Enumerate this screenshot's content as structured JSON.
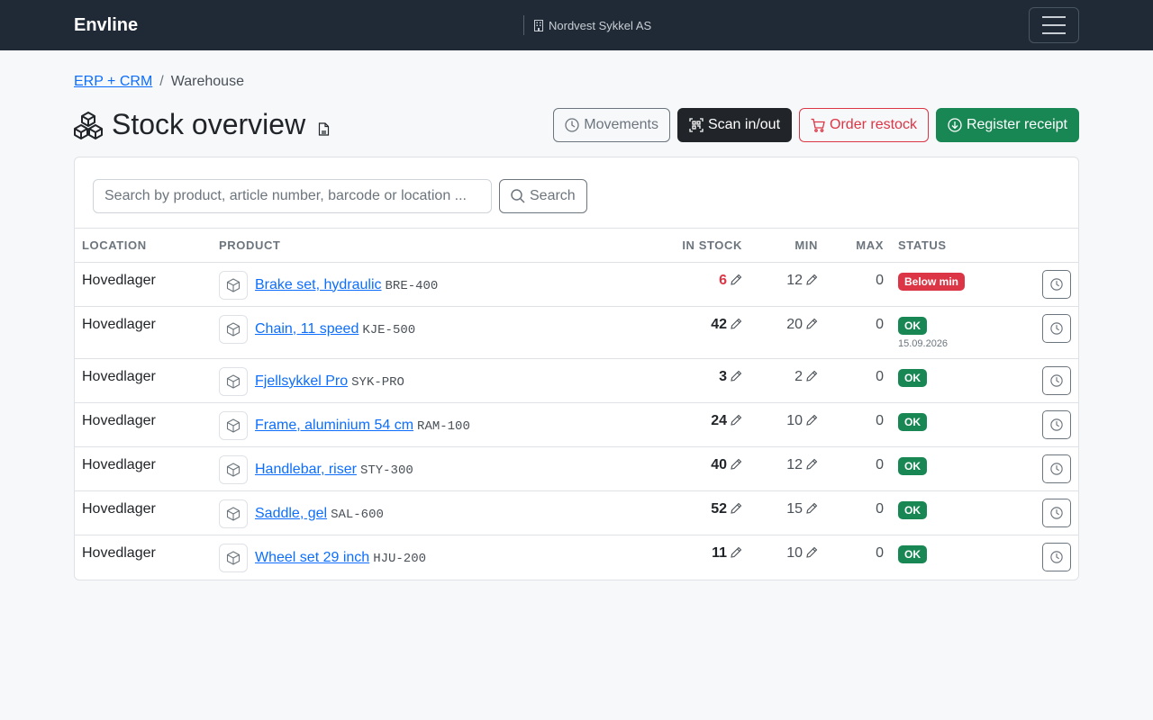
{
  "navbar": {
    "brand": "Envline",
    "company": "Nordvest Sykkel AS"
  },
  "breadcrumb": {
    "root": "ERP + CRM",
    "separator": "/",
    "current": "Warehouse"
  },
  "page": {
    "title": "Stock overview"
  },
  "actions": {
    "movements": "Movements",
    "scan": "Scan in/out",
    "restock": "Order restock",
    "receipt": "Register receipt"
  },
  "search": {
    "placeholder": "Search by product, article number, barcode or location ...",
    "button": "Search"
  },
  "table": {
    "headers": {
      "location": "LOCATION",
      "product": "PRODUCT",
      "in_stock": "IN STOCK",
      "min": "MIN",
      "max": "MAX",
      "status": "STATUS"
    },
    "rows": [
      {
        "location": "Hovedlager",
        "product": "Brake set, hydraulic",
        "sku": "BRE-400",
        "in_stock": "6",
        "min": "12",
        "max": "0",
        "status": "Below min",
        "status_note": ""
      },
      {
        "location": "Hovedlager",
        "product": "Chain, 11 speed",
        "sku": "KJE-500",
        "in_stock": "42",
        "min": "20",
        "max": "0",
        "status": "OK",
        "status_note": "15.09.2026"
      },
      {
        "location": "Hovedlager",
        "product": "Fjellsykkel Pro",
        "sku": "SYK-PRO",
        "in_stock": "3",
        "min": "2",
        "max": "0",
        "status": "OK",
        "status_note": ""
      },
      {
        "location": "Hovedlager",
        "product": "Frame, aluminium 54 cm",
        "sku": "RAM-100",
        "in_stock": "24",
        "min": "10",
        "max": "0",
        "status": "OK",
        "status_note": ""
      },
      {
        "location": "Hovedlager",
        "product": "Handlebar, riser",
        "sku": "STY-300",
        "in_stock": "40",
        "min": "12",
        "max": "0",
        "status": "OK",
        "status_note": ""
      },
      {
        "location": "Hovedlager",
        "product": "Saddle, gel",
        "sku": "SAL-600",
        "in_stock": "52",
        "min": "15",
        "max": "0",
        "status": "OK",
        "status_note": ""
      },
      {
        "location": "Hovedlager",
        "product": "Wheel set 29 inch",
        "sku": "HJU-200",
        "in_stock": "11",
        "min": "10",
        "max": "0",
        "status": "OK",
        "status_note": ""
      }
    ]
  },
  "colors": {
    "navbar": "#1f2a36",
    "link": "#0d6efd",
    "danger": "#dc3545",
    "success": "#198754",
    "dark": "#212529"
  }
}
